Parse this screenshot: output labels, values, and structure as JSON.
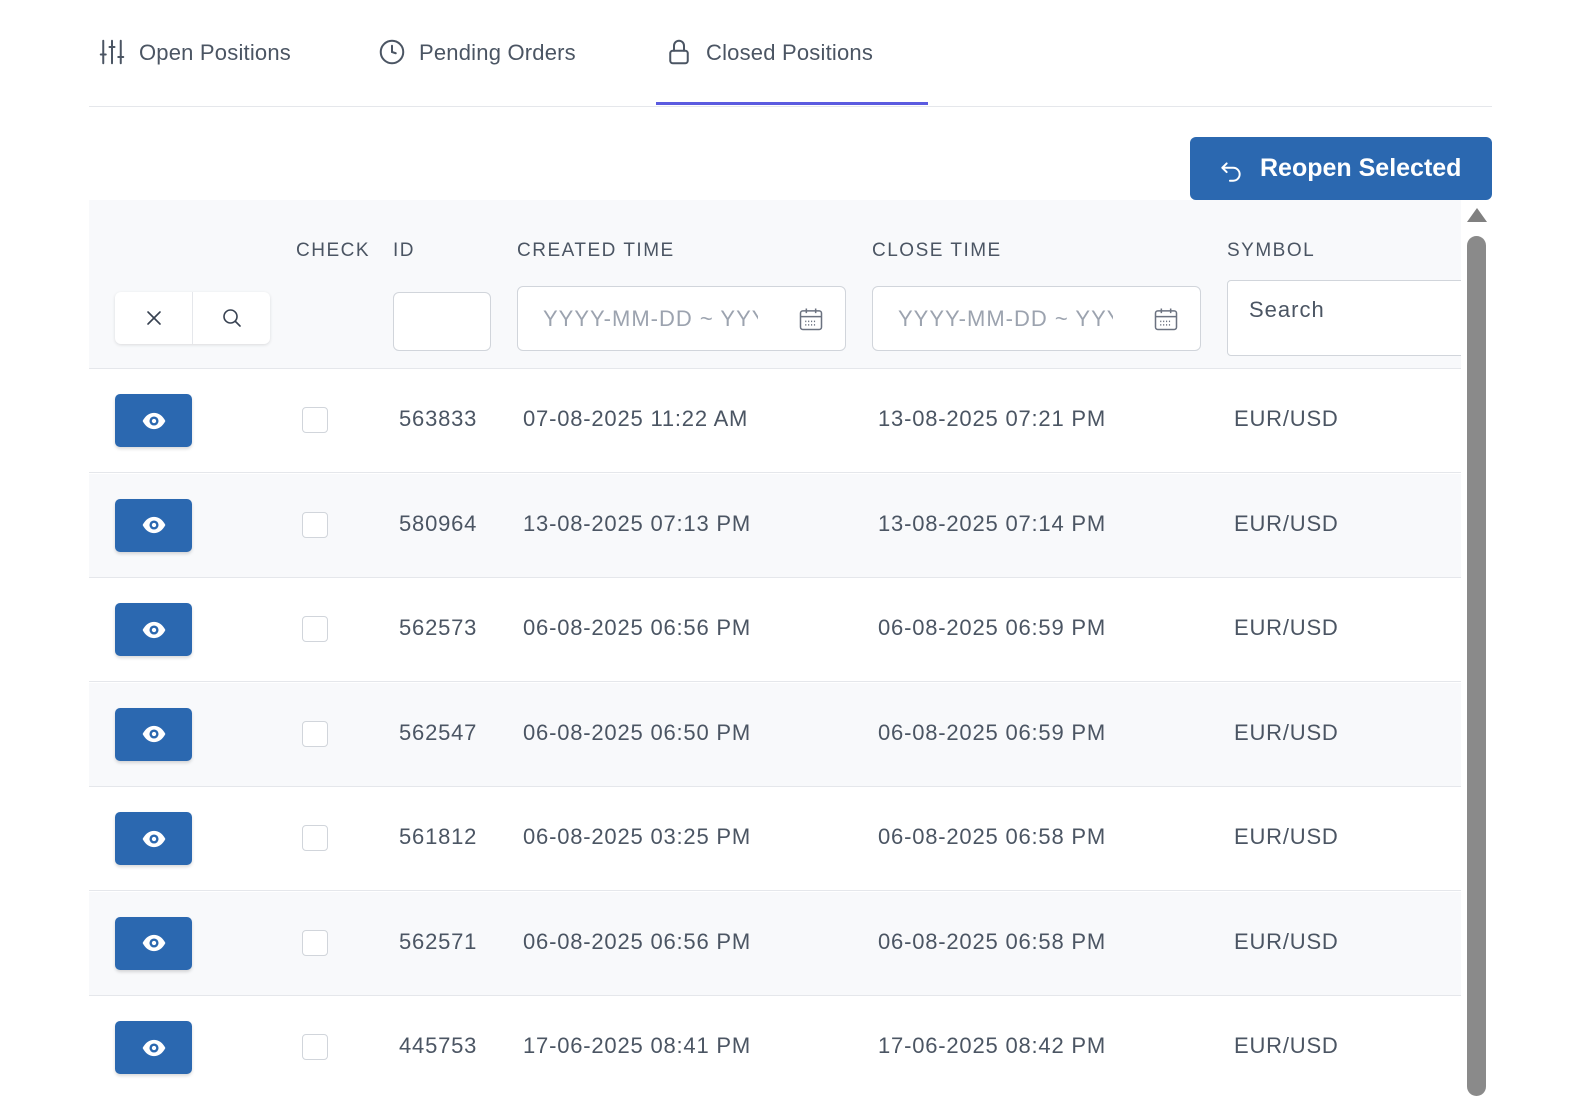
{
  "tabs": [
    {
      "label": "Open Positions",
      "icon": "sliders-icon",
      "active": false
    },
    {
      "label": "Pending Orders",
      "icon": "clock-icon",
      "active": false
    },
    {
      "label": "Closed Positions",
      "icon": "lock-icon",
      "active": true
    }
  ],
  "actions": {
    "reopen_label": "Reopen Selected",
    "reopen_icon": "undo-icon"
  },
  "table": {
    "headers": {
      "check": "CHECK",
      "id": "ID",
      "created_time": "CREATED TIME",
      "close_time": "CLOSE TIME",
      "symbol": "SYMBOL"
    },
    "filters": {
      "id_value": "",
      "created_placeholder": "YYYY-MM-DD ~ YYYY-MM-DD",
      "close_placeholder": "YYYY-MM-DD ~ YYYY-MM-DD",
      "symbol_placeholder": "Search"
    },
    "rows": [
      {
        "id": "563833",
        "created": "07-08-2025 11:22 AM",
        "closed": "13-08-2025 07:21 PM",
        "symbol": "EUR/USD"
      },
      {
        "id": "580964",
        "created": "13-08-2025 07:13 PM",
        "closed": "13-08-2025 07:14 PM",
        "symbol": "EUR/USD"
      },
      {
        "id": "562573",
        "created": "06-08-2025 06:56 PM",
        "closed": "06-08-2025 06:59 PM",
        "symbol": "EUR/USD"
      },
      {
        "id": "562547",
        "created": "06-08-2025 06:50 PM",
        "closed": "06-08-2025 06:59 PM",
        "symbol": "EUR/USD"
      },
      {
        "id": "561812",
        "created": "06-08-2025 03:25 PM",
        "closed": "06-08-2025 06:58 PM",
        "symbol": "EUR/USD"
      },
      {
        "id": "562571",
        "created": "06-08-2025 06:56 PM",
        "closed": "06-08-2025 06:58 PM",
        "symbol": "EUR/USD"
      },
      {
        "id": "445753",
        "created": "17-06-2025 08:41 PM",
        "closed": "17-06-2025 08:42 PM",
        "symbol": "EUR/USD"
      }
    ]
  },
  "colors": {
    "primary": "#2b68b0",
    "tab_accent": "#5b5be0",
    "row_alt": "#f8f9fb",
    "text": "#4b5563"
  }
}
